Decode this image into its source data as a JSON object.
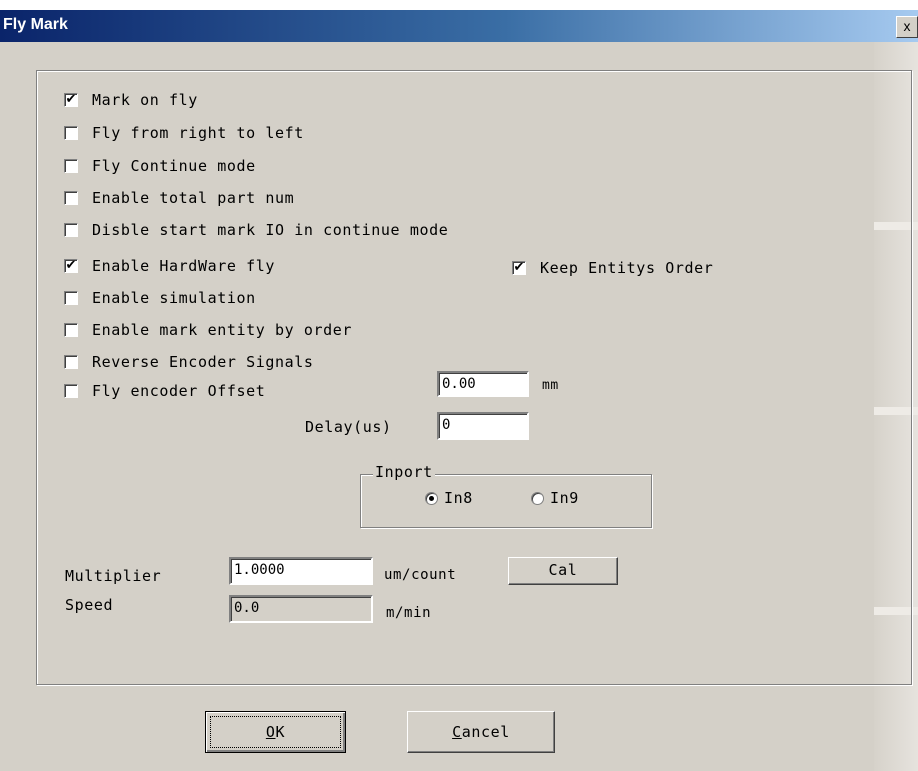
{
  "window": {
    "title": "Fly Mark",
    "close_glyph": "x"
  },
  "checkboxes": [
    {
      "label": "Mark on fly",
      "checked": true
    },
    {
      "label": "Fly from right to left",
      "checked": false
    },
    {
      "label": "Fly Continue mode",
      "checked": false
    },
    {
      "label": "Enable total part num",
      "checked": false
    },
    {
      "label": "Disble start mark IO in continue mode",
      "checked": false
    },
    {
      "label": "Enable HardWare fly",
      "checked": true
    },
    {
      "label": "Enable simulation",
      "checked": false
    },
    {
      "label": "Enable mark entity by order",
      "checked": false
    },
    {
      "label": "Reverse Encoder Signals",
      "checked": false
    },
    {
      "label": "Fly encoder Offset",
      "checked": false
    }
  ],
  "keep_order": {
    "label": "Keep Entitys Order",
    "checked": true
  },
  "offset": {
    "value": "0.00",
    "unit": "mm"
  },
  "delay": {
    "label": "Delay(us)",
    "value": "0"
  },
  "inport": {
    "legend": "Inport",
    "options": [
      {
        "label": "In8",
        "selected": true
      },
      {
        "label": "In9",
        "selected": false
      }
    ]
  },
  "multiplier": {
    "label": "Multiplier",
    "value": "1.0000",
    "unit": "um/count",
    "cal_label": "Cal"
  },
  "speed": {
    "label": "Speed",
    "value": "0.0",
    "unit": "m/min"
  },
  "buttons": {
    "ok_u": "O",
    "ok_rest": "K",
    "cancel_u": "C",
    "cancel_rest": "ancel"
  },
  "checkmark_glyph": "✔"
}
